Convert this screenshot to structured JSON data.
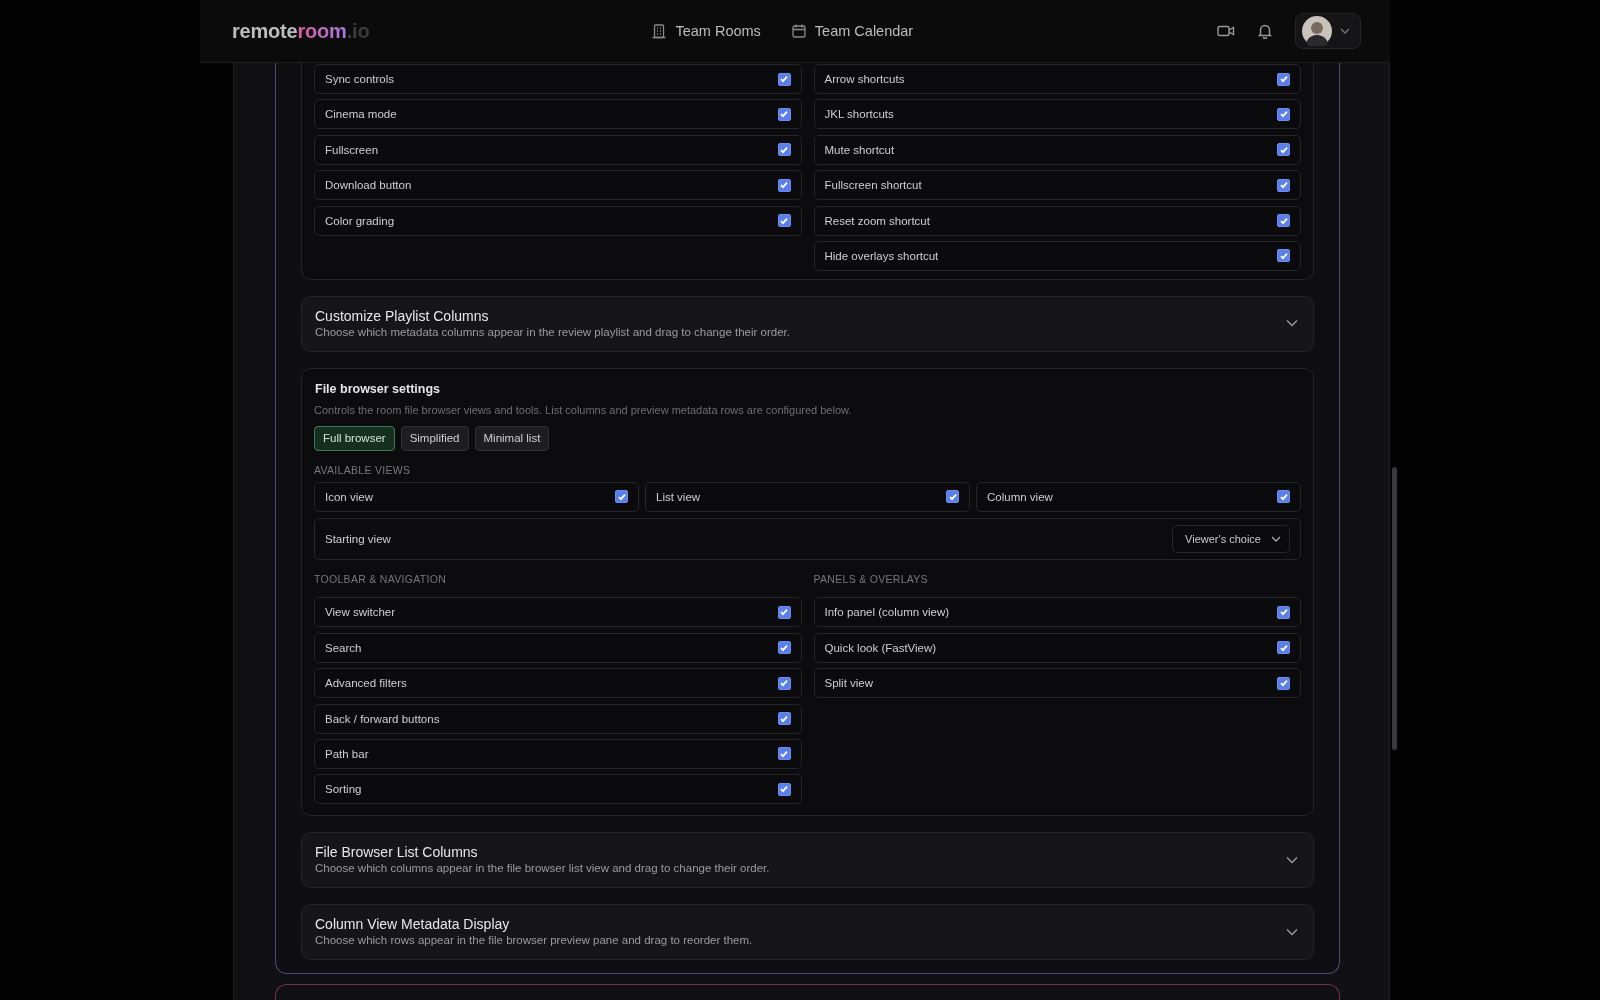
{
  "header": {
    "logo": [
      "remote",
      "room",
      ".io"
    ],
    "nav": [
      {
        "kind": "rooms",
        "label": "Team Rooms"
      },
      {
        "kind": "calendar",
        "label": "Team Calendar"
      }
    ]
  },
  "player_options": {
    "left": [
      {
        "label": "Sync controls",
        "checked": true
      },
      {
        "label": "Cinema mode",
        "checked": true
      },
      {
        "label": "Fullscreen",
        "checked": true
      },
      {
        "label": "Download button",
        "checked": true
      },
      {
        "label": "Color grading",
        "checked": true
      }
    ],
    "right": [
      {
        "label": "Arrow shortcuts",
        "checked": true
      },
      {
        "label": "JKL shortcuts",
        "checked": true
      },
      {
        "label": "Mute shortcut",
        "checked": true
      },
      {
        "label": "Fullscreen shortcut",
        "checked": true
      },
      {
        "label": "Reset zoom shortcut",
        "checked": true
      },
      {
        "label": "Hide overlays shortcut",
        "checked": true
      }
    ]
  },
  "playlist_columns": {
    "title": "Customize Playlist Columns",
    "description": "Choose which metadata columns appear in the review playlist and drag to change their order.",
    "expanded": false
  },
  "file_browser": {
    "title": "File browser settings",
    "description": "Controls the room file browser views and tools. List columns and preview metadata rows are configured below.",
    "presets": [
      {
        "label": "Full browser",
        "selected": true
      },
      {
        "label": "Simplified",
        "selected": false
      },
      {
        "label": "Minimal list",
        "selected": false
      }
    ],
    "available_views_heading": "AVAILABLE VIEWS",
    "views": [
      {
        "label": "Icon view",
        "checked": true
      },
      {
        "label": "List view",
        "checked": true
      },
      {
        "label": "Column view",
        "checked": true
      }
    ],
    "starting_view": {
      "label": "Starting view",
      "value": "Viewer's choice"
    },
    "toolbar_heading": "TOOLBAR & NAVIGATION",
    "toolbar": [
      {
        "label": "View switcher",
        "checked": true
      },
      {
        "label": "Search",
        "checked": true
      },
      {
        "label": "Advanced filters",
        "checked": true
      },
      {
        "label": "Back / forward buttons",
        "checked": true
      },
      {
        "label": "Path bar",
        "checked": true
      },
      {
        "label": "Sorting",
        "checked": true
      }
    ],
    "panels_heading": "PANELS & OVERLAYS",
    "panels": [
      {
        "label": "Info panel (column view)",
        "checked": true
      },
      {
        "label": "Quick look (FastView)",
        "checked": true
      },
      {
        "label": "Split view",
        "checked": true
      }
    ]
  },
  "list_columns": {
    "title": "File Browser List Columns",
    "description": "Choose which columns appear in the file browser list view and drag to change their order.",
    "expanded": false
  },
  "metadata_display": {
    "title": "Column View Metadata Display",
    "description": "Choose which rows appear in the file browser preview pane and drag to reorder them.",
    "expanded": false
  }
}
